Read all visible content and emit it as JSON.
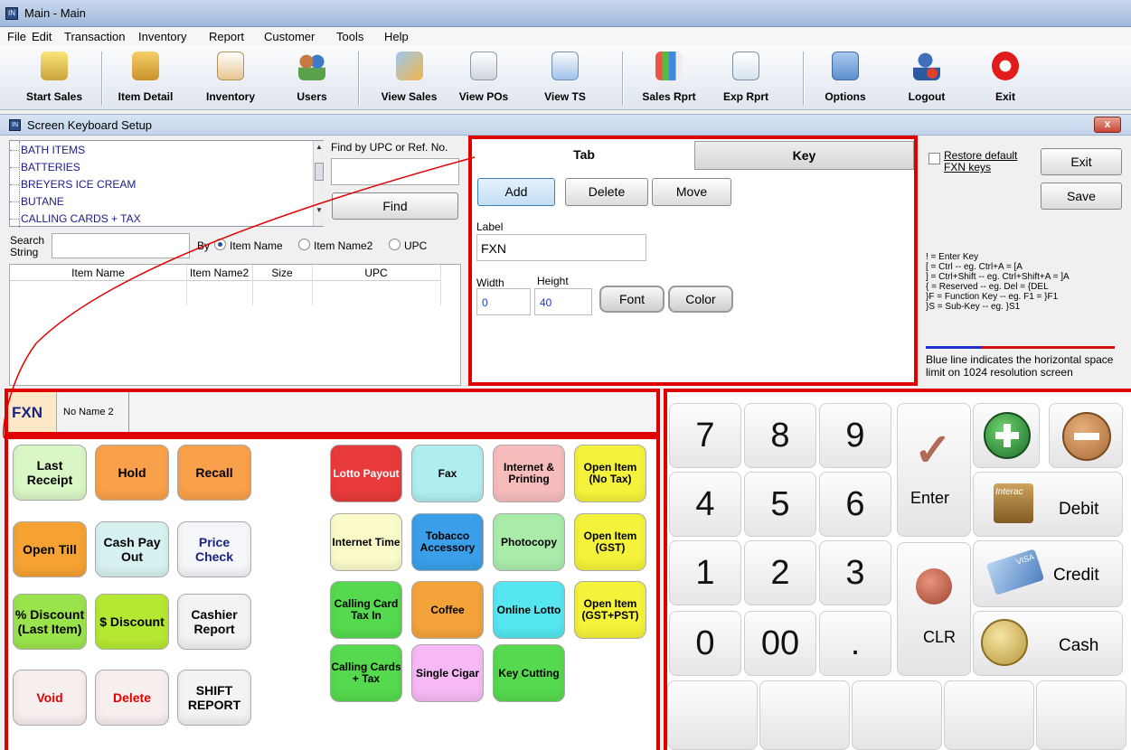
{
  "window": {
    "title": "Main - Main"
  },
  "menu": [
    "File",
    "Edit",
    "Transaction",
    "Inventory",
    "Report",
    "Customer",
    "Tools",
    "Help"
  ],
  "toolbar": [
    {
      "label": "Start Sales",
      "icon": "cash-register-icon"
    },
    {
      "label": "Item Detail",
      "icon": "boxes-icon"
    },
    {
      "label": "Inventory",
      "icon": "clipboard-icon"
    },
    {
      "label": "Users",
      "icon": "users-icon"
    },
    {
      "label": "View Sales",
      "icon": "view-sales-icon"
    },
    {
      "label": "View POs",
      "icon": "documents-icon"
    },
    {
      "label": "View TS",
      "icon": "calendar-chart-icon"
    },
    {
      "label": "Sales Rprt",
      "icon": "sales-report-icon"
    },
    {
      "label": "Exp Rprt",
      "icon": "expense-report-icon"
    },
    {
      "label": "Options",
      "icon": "options-icon"
    },
    {
      "label": "Logout",
      "icon": "logout-icon"
    },
    {
      "label": "Exit",
      "icon": "power-icon"
    }
  ],
  "dialog": {
    "title": "Screen Keyboard Setup",
    "close": "x"
  },
  "tree": {
    "items": [
      "BATH ITEMS",
      "BATTERIES",
      "BREYERS ICE CREAM",
      "BUTANE",
      "CALLING CARDS + TAX"
    ]
  },
  "search": {
    "upc_label": "Find by UPC or Ref. No.",
    "upc_value": "",
    "find": "Find",
    "search_label": "Search String",
    "search_value": "",
    "by_label": "By",
    "options": [
      "Item Name",
      "Item Name2",
      "UPC"
    ],
    "selected": "Item Name"
  },
  "grid": {
    "headers": [
      "Item Name",
      "Item Name2",
      "Size",
      "UPC"
    ]
  },
  "editor": {
    "tabs": [
      "Tab",
      "Key"
    ],
    "add": "Add",
    "delete": "Delete",
    "move": "Move",
    "label_caption": "Label",
    "label_value": "FXN",
    "width_caption": "Width",
    "width_value": "0",
    "height_caption": "Height",
    "height_value": "40",
    "font": "Font",
    "color": "Color"
  },
  "side": {
    "restore": "Restore default FXN keys",
    "exit": "Exit",
    "save": "Save",
    "legend": [
      "! = Enter Key",
      "[ = Ctrl -- eg. Ctrl+A = [A",
      "] = Ctrl+Shift -- eg. Ctrl+Shift+A = ]A",
      "{ = Reserved -- eg. Del = {DEL",
      "}F = Function Key -- eg. F1 = }F1",
      "}S = Sub-Key -- eg.  }S1"
    ],
    "note": "Blue line indicates the horizontal space limit on 1024 resolution screen"
  },
  "keytabs": [
    "FXN",
    "No Name 2"
  ],
  "keys_left": [
    {
      "label": "Last Receipt",
      "color": "#d9f7c5",
      "text": "#000"
    },
    {
      "label": "Hold",
      "color": "#f9a04a",
      "text": "#000"
    },
    {
      "label": "Recall",
      "color": "#f9a04a",
      "text": "#000"
    },
    {
      "label": "Open Till",
      "color": "#f5a233",
      "text": "#000"
    },
    {
      "label": "Cash Pay Out",
      "color": "#d7f0f0",
      "text": "#000"
    },
    {
      "label": "Price Check",
      "color": "#f4f6fa",
      "text": "#1a237e"
    },
    {
      "label": "% Discount (Last Item)",
      "color": "#9be34c",
      "text": "#000"
    },
    {
      "label": "$ Discount",
      "color": "#b5e832",
      "text": "#000"
    },
    {
      "label": "Cashier Report",
      "color": "#f3f3f3",
      "text": "#000"
    },
    {
      "label": "Void",
      "color": "#f7eeee",
      "text": "#e00000"
    },
    {
      "label": "Delete",
      "color": "#f7eeee",
      "text": "#e00000"
    },
    {
      "label": "SHIFT REPORT",
      "color": "#f3f3f3",
      "text": "#000"
    }
  ],
  "keys_right": [
    {
      "label": "Lotto Payout",
      "color": "#e83a3a",
      "text": "#fff"
    },
    {
      "label": "Fax",
      "color": "#aeeef0",
      "text": "#000"
    },
    {
      "label": "Internet & Printing",
      "color": "#f6bcbc",
      "text": "#000"
    },
    {
      "label": "Open Item (No Tax)",
      "color": "#f4f23a",
      "text": "#000"
    },
    {
      "label": "Internet Time",
      "color": "#fbfbc9",
      "text": "#000"
    },
    {
      "label": "Tobacco Accessory",
      "color": "#3a9fe8",
      "text": "#000"
    },
    {
      "label": "Photocopy",
      "color": "#a9ecaa",
      "text": "#000"
    },
    {
      "label": "Open Item (GST)",
      "color": "#f4f23a",
      "text": "#000"
    },
    {
      "label": "Calling Card Tax In",
      "color": "#55d94e",
      "text": "#000"
    },
    {
      "label": "Coffee",
      "color": "#f4a23a",
      "text": "#000"
    },
    {
      "label": "Online Lotto",
      "color": "#55e6ef",
      "text": "#000"
    },
    {
      "label": "Open Item (GST+PST)",
      "color": "#f4f23a",
      "text": "#000"
    },
    {
      "label": "Calling Cards + Tax",
      "color": "#55d94e",
      "text": "#000"
    },
    {
      "label": "Single Cigar",
      "color": "#f6b9f6",
      "text": "#000"
    },
    {
      "label": "Key Cutting",
      "color": "#55d94e",
      "text": "#000"
    }
  ],
  "numpad": {
    "digits": [
      "7",
      "8",
      "9",
      "4",
      "5",
      "6",
      "1",
      "2",
      "3",
      "0",
      "00",
      "."
    ],
    "enter": "Enter",
    "clr": "CLR",
    "debit": "Debit",
    "credit": "Credit",
    "cash": "Cash",
    "interac": "Interac",
    "visa": "VISA"
  }
}
